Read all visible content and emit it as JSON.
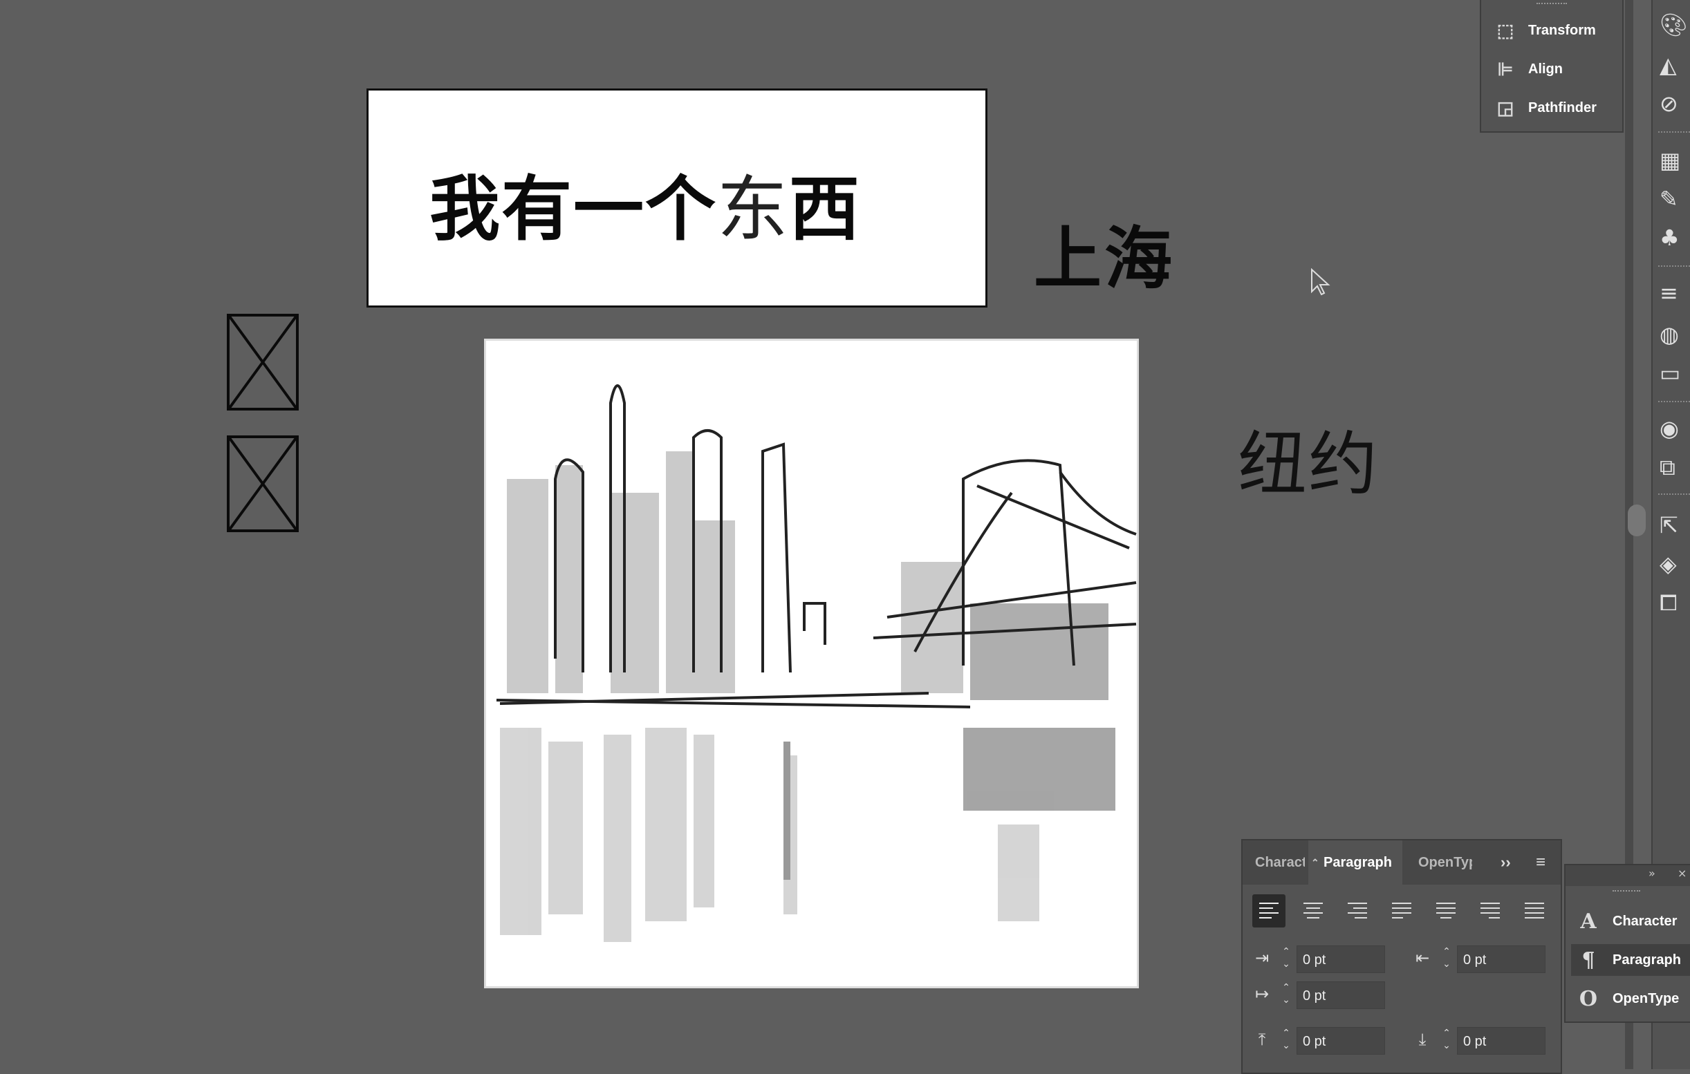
{
  "canvas": {
    "headline_bold_a": "我有一个",
    "headline_thin": "东",
    "headline_bold_b": "西",
    "shanghai": "上海",
    "newyork": "纽约"
  },
  "mini_panel": {
    "items": [
      {
        "label": "Transform",
        "icon": "transform-icon"
      },
      {
        "label": "Align",
        "icon": "align-icon"
      },
      {
        "label": "Pathfinder",
        "icon": "pathfinder-icon"
      }
    ]
  },
  "paragraph_panel": {
    "tabs": {
      "character": "Character",
      "paragraph": "Paragraph",
      "opentype": "OpenType",
      "more": "››",
      "menu": "≡"
    },
    "alignment_buttons": [
      "align-left",
      "align-center",
      "align-right",
      "justify-last-left",
      "justify-last-center",
      "justify-last-right",
      "justify-all"
    ],
    "left_indent": "0 pt",
    "right_indent": "0 pt",
    "first_line_indent": "0 pt",
    "space_before": "0 pt",
    "space_after": "0 pt"
  },
  "collapsed_panel": {
    "items": [
      {
        "label": "Character",
        "icon": "character-icon"
      },
      {
        "label": "Paragraph",
        "icon": "paragraph-icon"
      },
      {
        "label": "OpenType",
        "icon": "opentype-icon"
      }
    ],
    "expand": "»",
    "close": "×"
  },
  "colors": {
    "canvas_bg": "#5e5e5e",
    "panel_bg": "#535353",
    "panel_dark": "#474747",
    "artboard": "#ffffff"
  }
}
